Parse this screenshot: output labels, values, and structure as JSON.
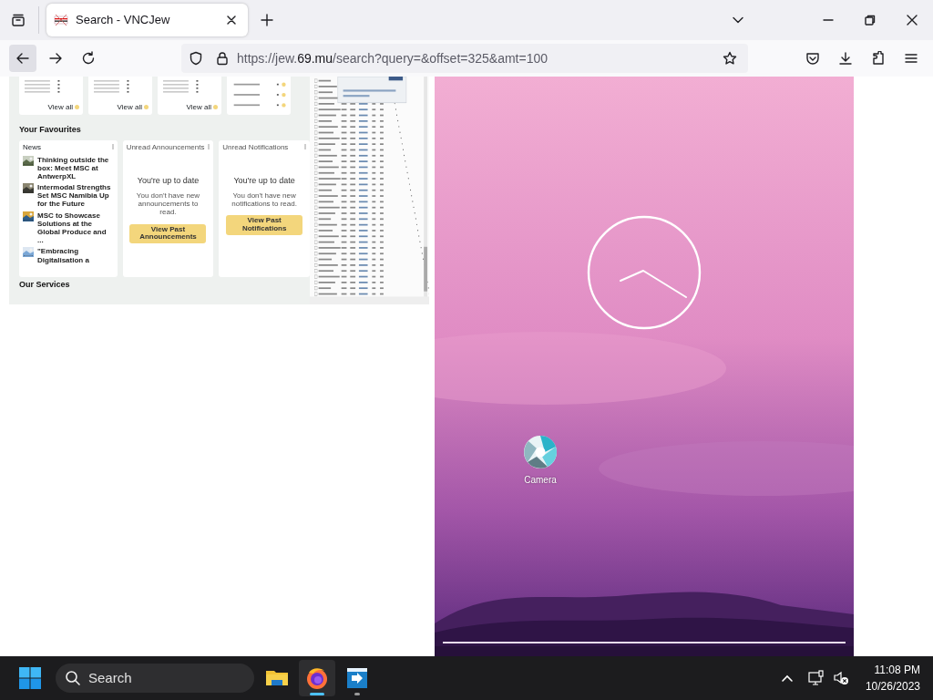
{
  "browser": {
    "tabs": [
      {
        "title": "Search - VNCJew",
        "selected": true
      }
    ],
    "url": "https://jew.**69.mu**/search?query=&offset=325&amt=100",
    "back_hovered": true
  },
  "portal_screenshot": {
    "top_cards": [
      {
        "kind": "counts",
        "link": "View all"
      },
      {
        "kind": "counts",
        "link": "View all"
      },
      {
        "kind": "counts",
        "link": "View all"
      },
      {
        "kind": "status"
      }
    ],
    "heading": "Your Favourites",
    "news": {
      "title": "News",
      "items": [
        "Thinking outside the box: Meet MSC at AntwerpXL",
        "Intermodal Strengths Set MSC Namibia Up for the Future",
        "MSC to Showcase Solutions at the Global Produce and ...",
        "\"Embracing Digitalisation a"
      ]
    },
    "panels": [
      {
        "title": "Unread Announcements",
        "status": "You're up to date",
        "message": "You don't have new announcements to read.",
        "button": "View Past Announcements"
      },
      {
        "title": "Unread Notifications",
        "status": "You're up to date",
        "message": "You don't have new notifications to read.",
        "button": "View Past Notifications"
      }
    ],
    "next_heading": "Our Services"
  },
  "phone_screenshot": {
    "apps": [
      {
        "label": "Camera"
      }
    ]
  },
  "taskbar": {
    "search_placeholder": "Search",
    "apps": [
      {
        "kind": "explorer",
        "selected": false,
        "running": false
      },
      {
        "kind": "firefox",
        "selected": true,
        "running": true
      },
      {
        "kind": "remote",
        "selected": false,
        "running": true
      }
    ],
    "time": "11:08 PM",
    "date": "10/26/2023"
  }
}
